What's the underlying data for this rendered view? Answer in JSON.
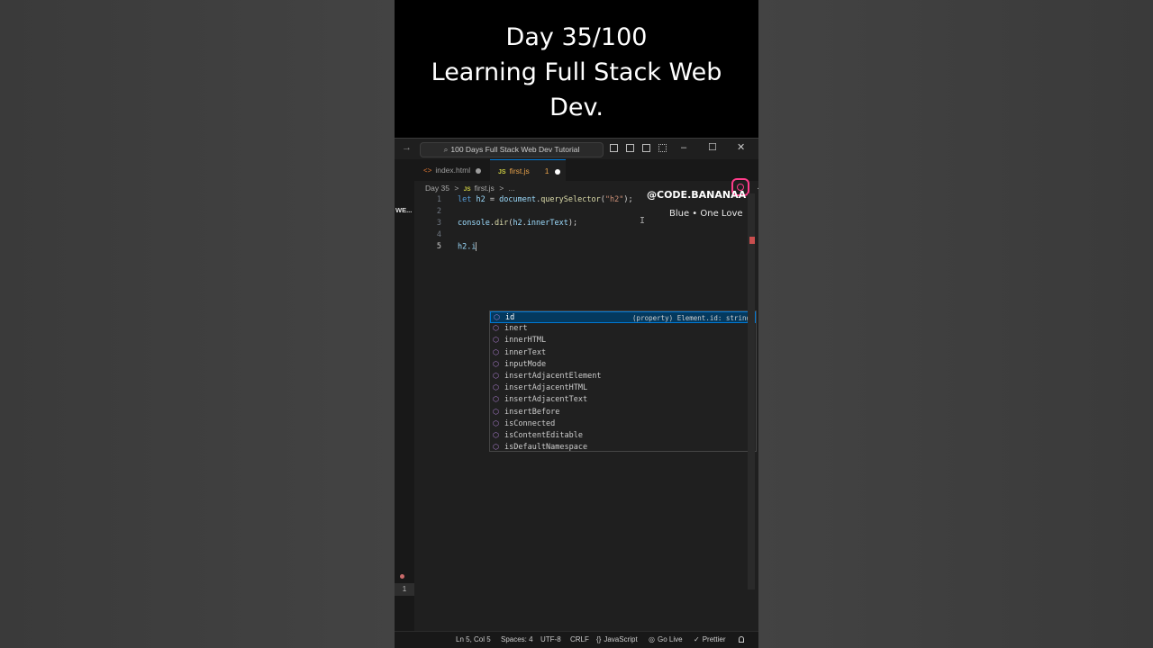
{
  "caption": {
    "line1": "Day 35/100",
    "line2": "Learning Full Stack Web",
    "line3": "Dev."
  },
  "titlebar": {
    "search_text": "100 Days Full Stack Web Dev Tutorial",
    "back_icon": "arrow-right-icon"
  },
  "activity": {
    "explorer_label": "WE...",
    "badge": "1"
  },
  "tabs": [
    {
      "label": "index.html",
      "icon": "html-file-icon",
      "modified": true,
      "active": false
    },
    {
      "label": "first.js",
      "icon": "js-file-icon",
      "problems": "1",
      "modified": true,
      "active": true
    }
  ],
  "breadcrumb": {
    "folder": "Day 35",
    "sep": ">",
    "file": "first.js",
    "more": "..."
  },
  "editor": {
    "line_numbers": [
      "1",
      "2",
      "3",
      "4",
      "5"
    ],
    "lines": [
      {
        "t1": "let",
        "t2": "h2",
        "t3": "=",
        "t4": "document",
        "t5": ".",
        "t6": "querySelector",
        "t7": "(",
        "t8": "\"h2\"",
        "t9": ");"
      },
      {
        "text": ""
      },
      {
        "t1": "console",
        "t2": ".",
        "t3": "dir",
        "t4": "(",
        "t5": "h2",
        "t6": ".",
        "t7": "innerText",
        "t8": ");"
      },
      {
        "text": ""
      },
      {
        "text": "h2.i"
      }
    ]
  },
  "watermark": {
    "handle": "@CODE.BANANAA",
    "song": "Blue • One Love"
  },
  "suggestions": {
    "selected_detail": "(property) Element.id: string",
    "items": [
      "id",
      "inert",
      "innerHTML",
      "innerText",
      "inputMode",
      "insertAdjacentElement",
      "insertAdjacentHTML",
      "insertAdjacentText",
      "insertBefore",
      "isConnected",
      "isContentEditable",
      "isDefaultNamespace"
    ]
  },
  "status": {
    "position": "Ln 5, Col 5",
    "spaces": "Spaces: 4",
    "encoding": "UTF-8",
    "eol": "CRLF",
    "language": "JavaScript",
    "golive": "Go Live",
    "prettier": "Prettier"
  },
  "colors": {
    "accent": "#0078d4",
    "editor_bg": "#1f1f1f",
    "keyword": "#569cd6",
    "string": "#ce9178"
  }
}
